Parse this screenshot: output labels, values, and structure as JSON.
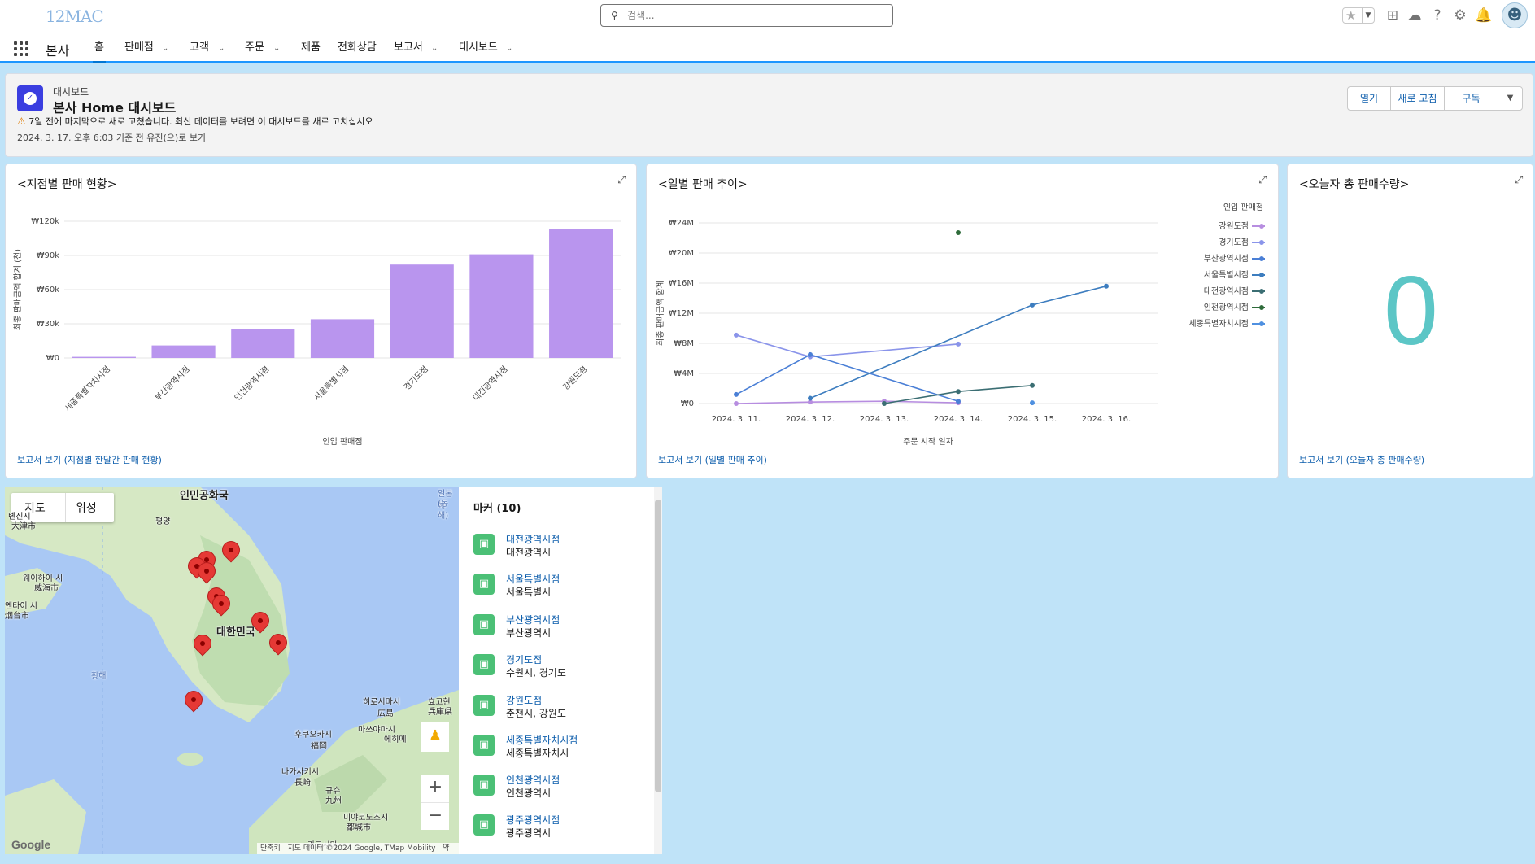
{
  "app": {
    "logo": "12MAC",
    "name": "본사"
  },
  "search": {
    "placeholder": "검색..."
  },
  "nav": {
    "items": [
      {
        "label": "홈",
        "active": true
      },
      {
        "label": "판매점",
        "dropdown": true
      },
      {
        "label": "고객",
        "dropdown": true
      },
      {
        "label": "주문",
        "dropdown": true
      },
      {
        "label": "제품",
        "dropdown": false
      },
      {
        "label": "전화상담",
        "dropdown": false
      },
      {
        "label": "보고서",
        "dropdown": true
      },
      {
        "label": "대시보드",
        "dropdown": true
      }
    ]
  },
  "dashboard": {
    "label": "대시보드",
    "title": "본사 Home 대시보드",
    "warning": "7일 전에 마지막으로 새로 고쳤습니다. 최신 데이터를 보려면 이 대시보드를 새로 고치십시오",
    "as_of": "2024. 3. 17. 오후 6:03 기준 전 유진(으)로 보기",
    "buttons": {
      "open": "열기",
      "refresh": "새로 고침",
      "subscribe": "구독"
    }
  },
  "cards": {
    "branch": {
      "title": "<지점별 판매 현황>",
      "report_link": "보고서 보기 (지점별 한달간 판매 현황)"
    },
    "daily": {
      "title": "<일별 판매 추이>",
      "report_link": "보고서 보기 (일별 판매 추이)"
    },
    "today": {
      "title": "<오늘자 총 판매수량>",
      "value": "0",
      "report_link": "보고서 보기 (오늘자 총 판매수량)"
    }
  },
  "chart_data": [
    {
      "type": "bar",
      "title": "<지점별 판매 현황>",
      "xlabel": "인입 판매점",
      "ylabel": "최종 판매금액 합계 (천)",
      "categories": [
        "세종특별자치시점",
        "부산광역시점",
        "인천광역시점",
        "서울특별시점",
        "경기도점",
        "대전광역시점",
        "강원도점"
      ],
      "values": [
        1,
        11,
        25,
        34,
        82,
        91,
        113
      ],
      "yticks": [
        "₩0",
        "₩30k",
        "₩60k",
        "₩90k",
        "₩120k"
      ],
      "ylim": [
        0,
        120
      ],
      "color": "#b995ee"
    },
    {
      "type": "line",
      "title": "<일별 판매 추이>",
      "xlabel": "주문 시작 일자",
      "ylabel": "최종 판매금액 합계",
      "legend_title": "인입 판매점",
      "x": [
        "2024. 3. 11.",
        "2024. 3. 12.",
        "2024. 3. 13.",
        "2024. 3. 14.",
        "2024. 3. 15.",
        "2024. 3. 16."
      ],
      "yticks": [
        "₩0",
        "₩4M",
        "₩8M",
        "₩12M",
        "₩16M",
        "₩20M",
        "₩24M"
      ],
      "ylim": [
        0,
        24
      ],
      "series": [
        {
          "name": "강원도점",
          "color": "#b78de0",
          "values": [
            0,
            0.2,
            0.3,
            0.1,
            null,
            null
          ]
        },
        {
          "name": "경기도점",
          "color": "#8a94ea",
          "values": [
            9.1,
            6.2,
            null,
            7.9,
            null,
            null
          ]
        },
        {
          "name": "부산광역시점",
          "color": "#4a7fd6",
          "values": [
            1.2,
            6.5,
            null,
            0.3,
            null,
            null
          ]
        },
        {
          "name": "서울특별시점",
          "color": "#3d7dbf",
          "values": [
            null,
            0.7,
            null,
            null,
            13.1,
            15.6
          ]
        },
        {
          "name": "대전광역시점",
          "color": "#3b6e73",
          "values": [
            null,
            null,
            0,
            1.6,
            2.4,
            null
          ]
        },
        {
          "name": "인천광역시점",
          "color": "#2e6b3a",
          "values": [
            null,
            null,
            null,
            22.7,
            null,
            null
          ]
        },
        {
          "name": "세종특별자치시점",
          "color": "#4f90e0",
          "values": [
            null,
            null,
            null,
            null,
            0.1,
            null
          ]
        }
      ]
    }
  ],
  "map": {
    "tabs": [
      "지도",
      "위성"
    ],
    "labels": [
      "인민공화국",
      "평양",
      "대한민국",
      "히로시마시",
      "広島",
      "후쿠오카시",
      "福岡",
      "나가사키시",
      "長崎",
      "웨이하이 시",
      "威海市",
      "옌타이 시",
      "烟台市",
      "톈진시",
      "大津市",
      "일본해",
      "(동해)",
      "황해",
      "규슈",
      "九州",
      "미야코노조시",
      "都城市",
      "가고시마",
      "효고현",
      "兵庫県",
      "마쓰야마시",
      "에히메"
    ],
    "footer": [
      "단축키",
      "지도 데이터 ©2024 Google, TMap Mobility",
      "약관"
    ],
    "google": "Google"
  },
  "markers": {
    "title": "마커 (10)",
    "items": [
      {
        "name": "대전광역시점",
        "addr": "대전광역시"
      },
      {
        "name": "서울특별시점",
        "addr": "서울특별시"
      },
      {
        "name": "부산광역시점",
        "addr": "부산광역시"
      },
      {
        "name": "경기도점",
        "addr": "수원시, 경기도"
      },
      {
        "name": "강원도점",
        "addr": "춘천시, 강원도"
      },
      {
        "name": "세종특별자치시점",
        "addr": "세종특별자치시"
      },
      {
        "name": "인천광역시점",
        "addr": "인천광역시"
      },
      {
        "name": "광주광역시점",
        "addr": "광주광역시"
      }
    ]
  }
}
